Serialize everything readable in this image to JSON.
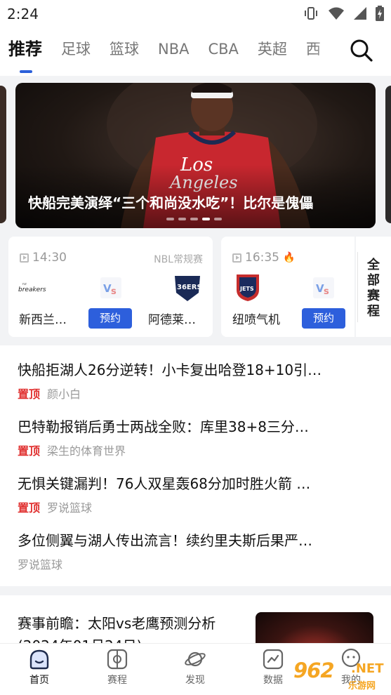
{
  "status_bar": {
    "time": "2:24"
  },
  "tabs": [
    {
      "label": "推荐",
      "active": true
    },
    {
      "label": "足球"
    },
    {
      "label": "篮球"
    },
    {
      "label": "NBA"
    },
    {
      "label": "CBA"
    },
    {
      "label": "英超"
    },
    {
      "label": "西"
    }
  ],
  "banner": {
    "title": "快船完美演绎“三个和尚没水吃”！比尔是傀儡",
    "slide_count": 5,
    "active_slide": 4
  },
  "matches": [
    {
      "time": "14:30",
      "hot": false,
      "league": "NBL常规赛",
      "home_name": "新西兰…",
      "away_name": "阿德莱…",
      "action": "预约",
      "home_logo_text": "breakers",
      "away_logo_text": "36ERS"
    },
    {
      "time": "16:35",
      "hot": true,
      "league": "",
      "home_name": "纽喷气机",
      "action": "预约",
      "home_logo_text": "JETS"
    }
  ],
  "all_matches_label": "全部赛程",
  "news": [
    {
      "title": "快船拒湖人26分逆转！小卡复出哈登18+10引…",
      "pinned": true,
      "pin_label": "置顶",
      "source": "颜小白"
    },
    {
      "title": "巴特勒报销后勇士两战全败：库里38+8三分…",
      "pinned": true,
      "pin_label": "置顶",
      "source": "梁生的体育世界"
    },
    {
      "title": "无惧关键漏判！76人双星轰68分加时胜火箭 …",
      "pinned": true,
      "pin_label": "置顶",
      "source": "罗说篮球"
    },
    {
      "title": "多位侧翼与湖人传出流言！续约里夫斯后果严…",
      "pinned": false,
      "source": "罗说篮球"
    }
  ],
  "feature": {
    "title": "赛事前瞻：太阳vs老鹰预测分析(2024年01月24日)"
  },
  "bottom_nav": [
    {
      "label": "首页",
      "icon": "home-icon",
      "active": true
    },
    {
      "label": "赛程",
      "icon": "schedule-icon"
    },
    {
      "label": "发现",
      "icon": "planet-icon"
    },
    {
      "label": "数据",
      "icon": "data-chart-icon"
    },
    {
      "label": "我的",
      "icon": "profile-icon"
    }
  ],
  "watermark": {
    "num": "962",
    "net": ".NET",
    "cn": "乐游网"
  },
  "colors": {
    "accent": "#2d5fdc",
    "pin": "#e0302f",
    "jersey": "#c8272f"
  }
}
